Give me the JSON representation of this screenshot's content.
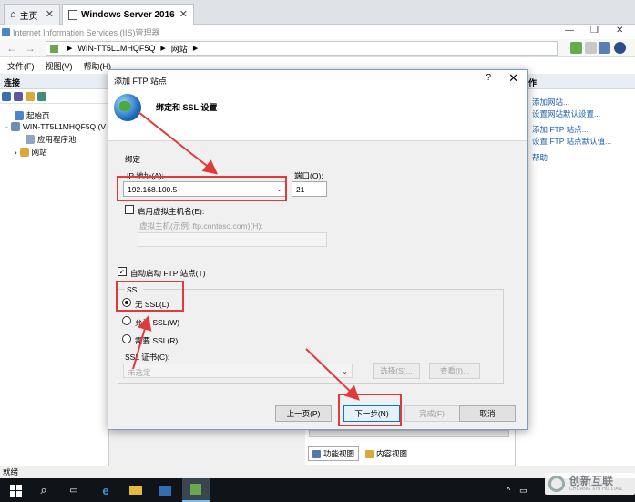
{
  "tabs": [
    {
      "label": "主页"
    },
    {
      "label": "Windows Server 2016"
    }
  ],
  "window": {
    "title": "Internet Information Services (IIS)管理器"
  },
  "address": {
    "segments": [
      "WIN-TT5L1MHQF5Q",
      "网站"
    ]
  },
  "menu": [
    "文件(F)",
    "视图(V)",
    "帮助(H)"
  ],
  "left": {
    "header": "连接",
    "tree": [
      {
        "label": "起始页"
      },
      {
        "label": "WIN-TT5L1MHQF5Q (V"
      },
      {
        "label": "应用程序池"
      },
      {
        "label": "网站"
      }
    ]
  },
  "right": {
    "header": "作",
    "actions": [
      "添加网站...",
      "设置网站默认设置...",
      "添加 FTP 站点...",
      "设置 FTP 站点默认值...",
      "帮助"
    ]
  },
  "view_tabs": [
    "功能视图",
    "内容视图"
  ],
  "status": "就绪",
  "dialog": {
    "title": "添加 FTP 站点",
    "help": "?",
    "heading": "绑定和 SSL 设置",
    "binding_group": "绑定",
    "ip_label": "IP 地址(A):",
    "ip_value": "192.168.100.5",
    "port_label": "端口(O):",
    "port_value": "21",
    "vhost_check_label": "启用虚拟主机名(E):",
    "vhost_hint": "虚拟主机(示例: ftp.contoso.com)(H):",
    "autostart_label": "自动启动 FTP 站点(T)",
    "ssl_group": "SSL",
    "ssl_none": "无 SSL(L)",
    "ssl_allow": "允许 SSL(W)",
    "ssl_require": "需要 SSL(R)",
    "cert_label": "SSL 证书(C):",
    "cert_value": "未选定",
    "select_btn": "选择(S)...",
    "view_btn": "查看(I)...",
    "prev_btn": "上一页(P)",
    "next_btn": "下一步(N)",
    "finish_btn": "完成(F)",
    "cancel_btn": "取消"
  },
  "watermark": {
    "text": "创新互联",
    "sub": "CHUANG XIN HU LIAN"
  },
  "colors": {
    "annotation_red": "#e03a3a",
    "link_blue": "#1a5fb4",
    "accent": "#0078d7"
  }
}
